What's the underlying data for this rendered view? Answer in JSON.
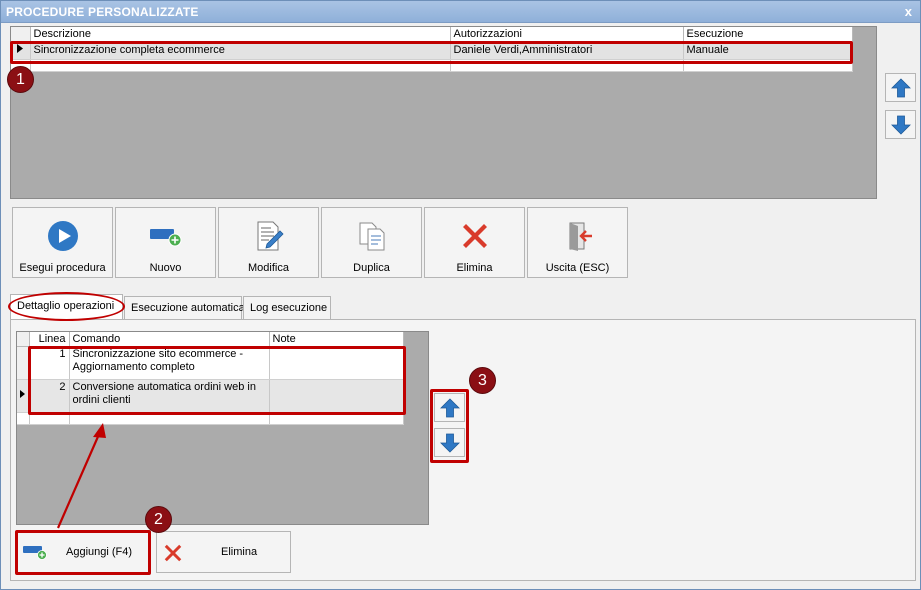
{
  "window": {
    "title": "PROCEDURE PERSONALIZZATE",
    "close_glyph": "x"
  },
  "procedures_grid": {
    "columns": [
      "Descrizione",
      "Autorizzazioni",
      "Esecuzione"
    ],
    "rows": [
      {
        "descrizione": "Sincronizzazione completa ecommerce",
        "autorizzazioni": "Daniele Verdi,Amministratori",
        "esecuzione": "Manuale",
        "selected": true
      }
    ]
  },
  "toolbar": [
    {
      "label": "Esegui procedura",
      "icon": "play-icon",
      "enabled": true
    },
    {
      "label": "Nuovo",
      "icon": "new-icon",
      "enabled": true
    },
    {
      "label": "Modifica",
      "icon": "edit-icon",
      "enabled": true
    },
    {
      "label": "Duplica",
      "icon": "duplicate-icon",
      "enabled": false
    },
    {
      "label": "Elimina",
      "icon": "delete-icon",
      "enabled": true
    },
    {
      "label": "Uscita (ESC)",
      "icon": "exit-icon",
      "enabled": true
    }
  ],
  "tabs": [
    {
      "label": "Dettaglio operazioni",
      "active": true
    },
    {
      "label": "Esecuzione automatica",
      "active": false
    },
    {
      "label": "Log esecuzione",
      "active": false
    }
  ],
  "operations_grid": {
    "columns": [
      "Linea",
      "Comando",
      "Note"
    ],
    "rows": [
      {
        "linea": "1",
        "comando": "Sincronizzazione sito ecommerce - Aggiornamento completo",
        "note": ""
      },
      {
        "linea": "2",
        "comando": "Conversione automatica ordini web in ordini clienti",
        "note": "",
        "current": true
      }
    ]
  },
  "bottom_buttons": {
    "add_label": "Aggiungi (F4)",
    "delete_label": "Elimina"
  },
  "annotations": {
    "badge_1": "1",
    "badge_2": "2",
    "badge_3": "3"
  },
  "colors": {
    "accent_red": "#c00000",
    "badge_bg": "#8b0f14",
    "icon_blue": "#3a7fc8",
    "title_bar": "#9bb9de"
  }
}
